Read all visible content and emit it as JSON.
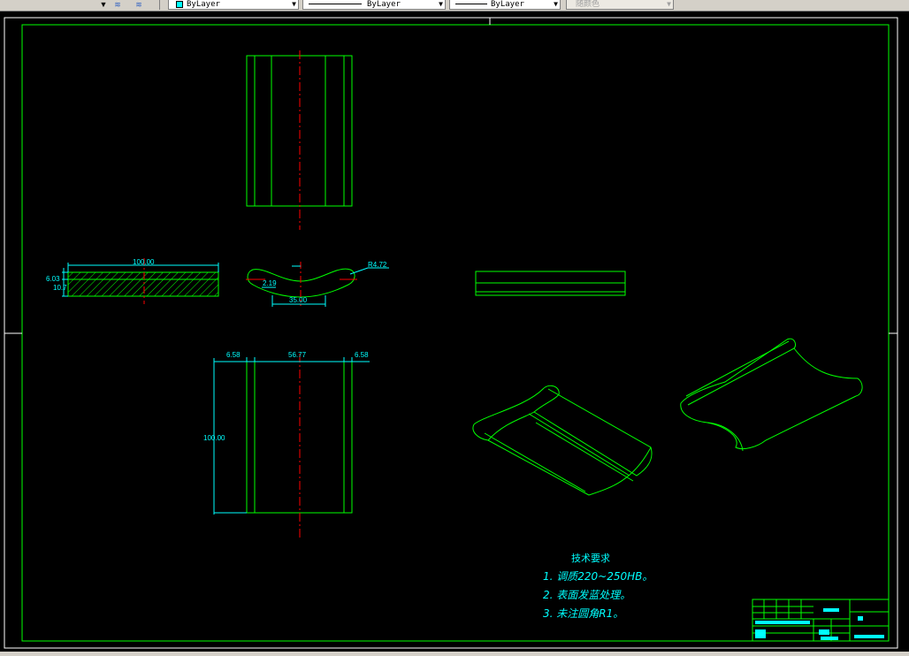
{
  "toolbar": {
    "color_value": "ByLayer",
    "linetype_value": "ByLayer",
    "lineweight_value": "ByLayer",
    "plotstyle_value": "随颜色",
    "layer_icons": [
      "layer-state-icon",
      "layer-previous-icon"
    ]
  },
  "drawing": {
    "colors": {
      "geometry": "#00ff00",
      "dimension": "#00ffff",
      "centerline": "#ff0000",
      "background": "#000000"
    },
    "dimensions": {
      "width_top": "100.00",
      "thickness": "6.03",
      "flange": "10.7",
      "radius": "R4.72",
      "depth": "2.19",
      "groove_width": "35.00",
      "side_left": "6.58",
      "center_width": "56.77",
      "side_right": "6.58",
      "length": "100.00"
    },
    "notes": {
      "title": "技术要求",
      "items": [
        "1. 调质220~250HB。",
        "2. 表面发蓝处理。",
        "3. 未注圆角R1。"
      ]
    }
  }
}
